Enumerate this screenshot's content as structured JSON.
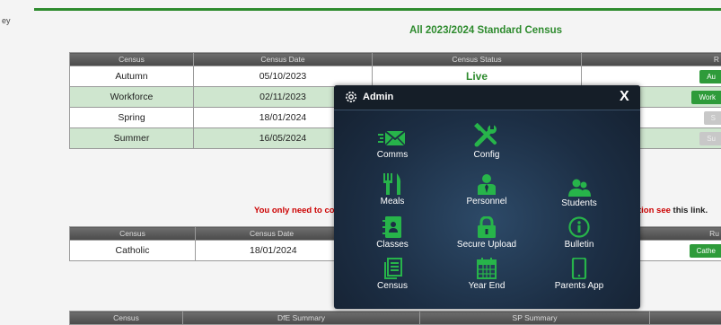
{
  "corner_text": "ey",
  "page_title": "All 2023/2024 Standard Census",
  "census_table": {
    "headers": [
      "Census",
      "Census Date",
      "Census Status",
      "R"
    ],
    "rows": [
      {
        "census": "Autumn",
        "date": "05/10/2023",
        "status": "Live",
        "action": "Au"
      },
      {
        "census": "Workforce",
        "date": "02/11/2023",
        "status": "",
        "action": "Work"
      },
      {
        "census": "Spring",
        "date": "18/01/2024",
        "status": "",
        "action": "S"
      },
      {
        "census": "Summer",
        "date": "16/05/2024",
        "status": "",
        "action": "Su"
      }
    ]
  },
  "notice": {
    "left_text": "You only need to co",
    "right_text": "tion see",
    "link_text": "this link."
  },
  "catholic_table": {
    "headers": [
      "Census",
      "Census Date",
      "Ru"
    ],
    "rows": [
      {
        "census": "Catholic",
        "date": "18/01/2024",
        "action": "Cathe"
      }
    ]
  },
  "summary_table": {
    "headers": [
      "Census",
      "DfE Summary",
      "SP Summary"
    ]
  },
  "modal": {
    "title": "Admin",
    "close": "X",
    "tiles": [
      {
        "label": "Comms",
        "icon": "envelope-icon"
      },
      {
        "label": "Config",
        "icon": "tools-icon"
      },
      {
        "label": "Meals",
        "icon": "cutlery-icon"
      },
      {
        "label": "Personnel",
        "icon": "personnel-icon"
      },
      {
        "label": "Students",
        "icon": "students-icon"
      },
      {
        "label": "Classes",
        "icon": "address-book-icon"
      },
      {
        "label": "Secure Upload",
        "icon": "lock-icon"
      },
      {
        "label": "Bulletin",
        "icon": "info-icon"
      },
      {
        "label": "Census",
        "icon": "census-icon"
      },
      {
        "label": "Year End",
        "icon": "calendar-icon"
      },
      {
        "label": "Parents App",
        "icon": "phone-icon"
      }
    ]
  },
  "colors": {
    "accent": "#2e8b2e",
    "icon_green": "#27b44a",
    "modal_bg": "#1c2e44",
    "row_alt": "#cfe6cf",
    "warning": "#cc0000"
  }
}
